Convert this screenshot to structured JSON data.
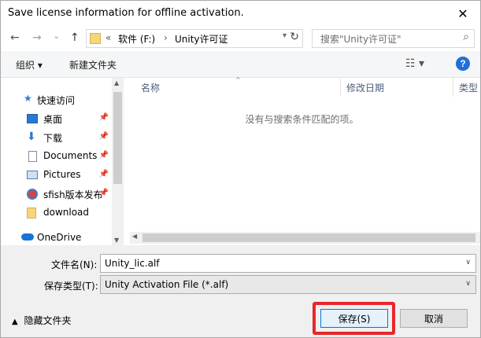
{
  "window": {
    "title": "Save license information for offline activation.",
    "close_glyph": "✕"
  },
  "nav": {
    "back": "←",
    "forward": "→",
    "dropdown": "⌄",
    "up": "↑",
    "address": {
      "chevron": "«",
      "crumbs": [
        "软件 (F:)",
        "Unity许可证"
      ],
      "sep": "›"
    },
    "search_placeholder": "搜索\"Unity许可证\""
  },
  "toolbar": {
    "organize": "组织 ▾",
    "new_folder": "新建文件夹"
  },
  "sidebar": {
    "items": [
      {
        "label": "快速访问",
        "icon": "star-icon"
      },
      {
        "label": "桌面",
        "icon": "desktop-icon",
        "pinned": true
      },
      {
        "label": "下载",
        "icon": "download-arrow-icon",
        "pinned": true
      },
      {
        "label": "Documents",
        "icon": "documents-icon",
        "pinned": true
      },
      {
        "label": "Pictures",
        "icon": "pictures-icon",
        "pinned": true
      },
      {
        "label": "sfish版本发布",
        "icon": "sfish-icon",
        "pinned": true
      },
      {
        "label": "download",
        "icon": "folder-icon"
      },
      {
        "label": "OneDrive",
        "icon": "cloud-icon"
      }
    ]
  },
  "files": {
    "columns": [
      "名称",
      "修改日期",
      "类型"
    ],
    "empty_message": "没有与搜索条件匹配的项。"
  },
  "form": {
    "filename_label": "文件名(N):",
    "filename_value": "Unity_lic.alf",
    "filetype_label": "保存类型(T):",
    "filetype_value": "Unity Activation File (*.alf)"
  },
  "footer": {
    "hide_folders": "隐藏文件夹",
    "save": "保存(S)",
    "cancel": "取消"
  },
  "colors": {
    "highlight": "#e8262b",
    "accent": "#0078d7"
  }
}
